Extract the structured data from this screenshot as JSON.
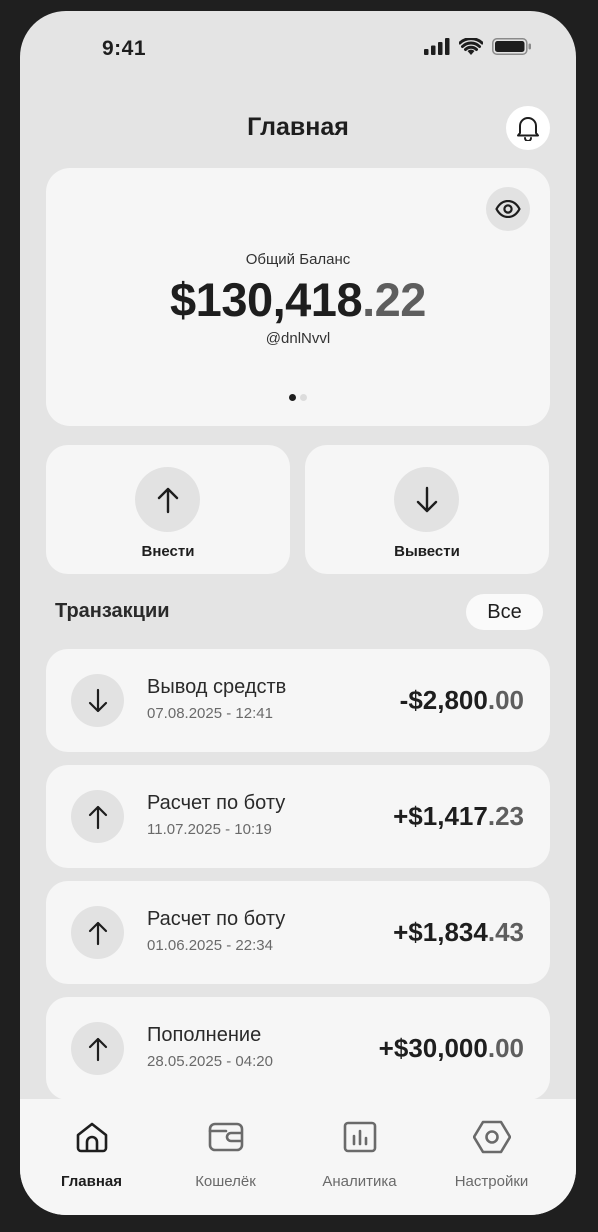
{
  "status": {
    "time": "9:41"
  },
  "header": {
    "title": "Главная"
  },
  "balance": {
    "label": "Общий Баланс",
    "whole": "$130,418",
    "cents": ".22",
    "username": "@dnlNvvl"
  },
  "actions": {
    "deposit": "Внести",
    "withdraw": "Вывести"
  },
  "transactions": {
    "title": "Транзакции",
    "all_label": "Все",
    "items": [
      {
        "title": "Вывод средств",
        "date": "07.08.2025 - 12:41",
        "whole": "-$2,800",
        "cents": ".00",
        "direction": "down"
      },
      {
        "title": "Расчет по боту",
        "date": "11.07.2025 - 10:19",
        "whole": "+$1,417",
        "cents": ".23",
        "direction": "up"
      },
      {
        "title": "Расчет по боту",
        "date": "01.06.2025 - 22:34",
        "whole": "+$1,834",
        "cents": ".43",
        "direction": "up"
      },
      {
        "title": "Пополнение",
        "date": "28.05.2025 - 04:20",
        "whole": "+$30,000",
        "cents": ".00",
        "direction": "up"
      }
    ]
  },
  "tabbar": {
    "items": [
      {
        "label": "Главная",
        "icon": "home-icon",
        "active": true
      },
      {
        "label": "Кошелёк",
        "icon": "wallet-icon",
        "active": false
      },
      {
        "label": "Аналитика",
        "icon": "analytics-icon",
        "active": false
      },
      {
        "label": "Настройки",
        "icon": "settings-icon",
        "active": false
      }
    ]
  },
  "colors": {
    "background": "#1f1f1f",
    "screen": "#e4e4e4",
    "card": "#f6f6f6",
    "text": "#1e1e1e",
    "muted": "#5e5e5e"
  }
}
